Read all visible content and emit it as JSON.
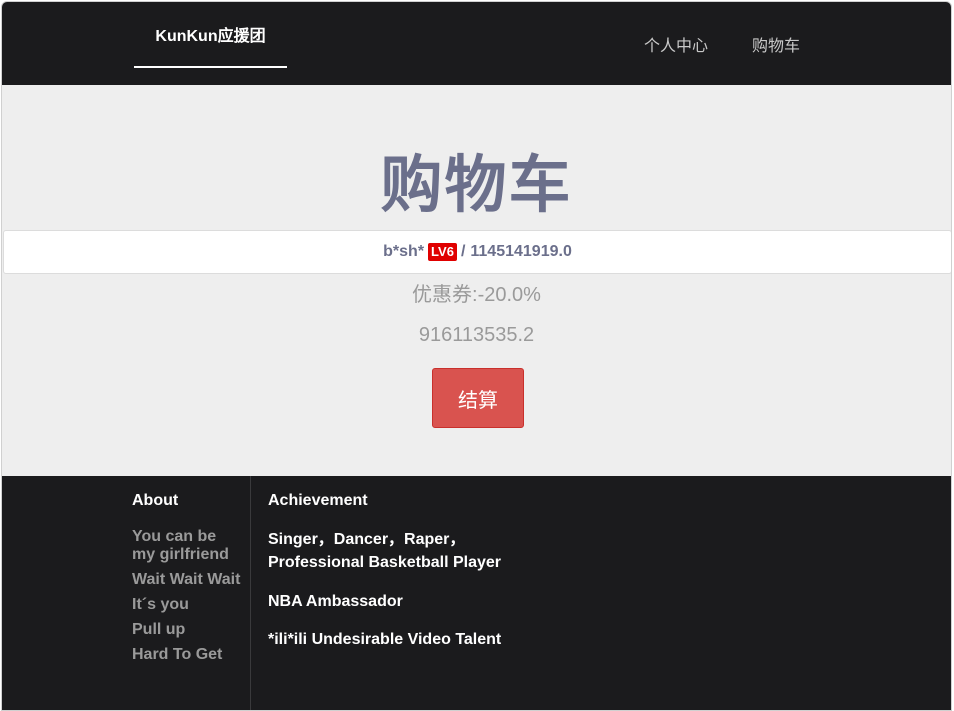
{
  "navbar": {
    "brand": "KunKun应援团",
    "links": [
      "个人中心",
      "购物车"
    ]
  },
  "main": {
    "title": "购物车",
    "order": {
      "user": "b*sh*",
      "level": "LV6",
      "separator": "/",
      "amount": "1145141919.0"
    },
    "coupon": "优惠券:-20.0%",
    "total": "916113535.2",
    "checkout_label": "结算"
  },
  "footer": {
    "about_title": "About",
    "about_items": [
      "You can be my girlfriend",
      "Wait Wait Wait",
      "It´s you",
      "Pull up",
      "Hard To Get"
    ],
    "achievement_title": "Achievement",
    "achievements": [
      "Singer，Dancer，Raper，Professional Basketball Player",
      "NBA Ambassador",
      "*ili*ili Undesirable Video Talent"
    ]
  },
  "colors": {
    "navbar_bg": "#1b1b1d",
    "title": "#6b6f8b",
    "checkout": "#d9534f",
    "level_badge": "#e00000"
  }
}
